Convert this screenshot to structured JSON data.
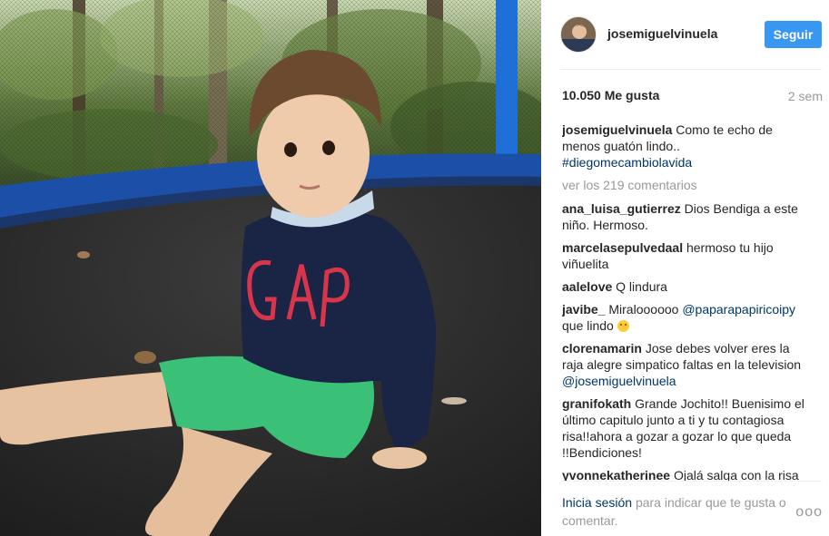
{
  "photo": {
    "alt": ""
  },
  "header": {
    "username": "josemiguelvinuela",
    "follow_label": "Seguir"
  },
  "stats": {
    "likes": "10.050 Me gusta",
    "age": "2 sem"
  },
  "caption": {
    "user": "josemiguelvinuela",
    "text": "Como te echo de menos guatón lindo..",
    "hashtag": "#diegomecambiolavida"
  },
  "view_all": "ver los 219 comentarios",
  "comments": [
    {
      "user": "ana_luisa_gutierrez",
      "text": "Dios Bendiga a este niño. Hermoso."
    },
    {
      "user": "marcelasepulvedaal",
      "text": "hermoso tu hijo viñuelita"
    },
    {
      "user": "aalelove",
      "text": "Q lindura"
    },
    {
      "user": "javibe_",
      "text": "Miraloooooo",
      "mention": "@paparapapiricoipy",
      "after": "que lindo",
      "emoji": "smiling-face"
    },
    {
      "user": "clorenamarin",
      "text": "Jose debes volver eres la raja alegre simpatico faltas en la television",
      "mention": "@josemiguelvinuela"
    },
    {
      "user": "granifokath",
      "text": "Grande Jochito!! Buenisimo el último capitulo junto a ti y tu contagiosa risa!!ahora a gozar a gozar lo que queda !!Bendiciones!"
    },
    {
      "user": "yvonnekatherinee",
      "text": "Ojalá salga con la risa"
    }
  ],
  "footer": {
    "login": "Inicia sesión",
    "rest": "para indicar que te gusta o comentar."
  },
  "more_label": "ooo",
  "colors": {
    "accent": "#3897f0",
    "link": "#003569",
    "muted": "#999999",
    "text": "#262626"
  }
}
